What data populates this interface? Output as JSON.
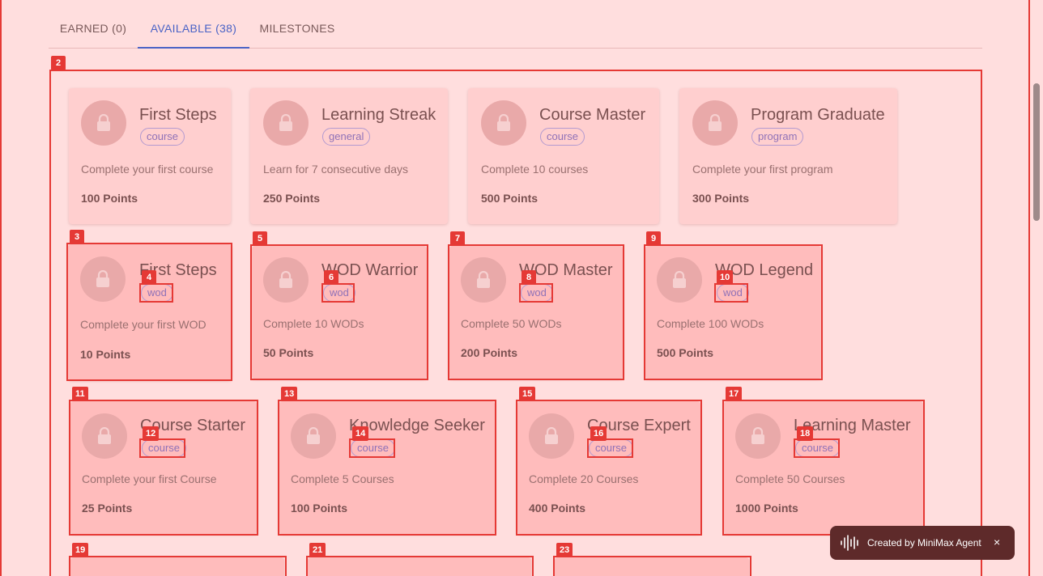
{
  "tabs": {
    "earned": "EARNED (0)",
    "available": "AVAILABLE (38)",
    "milestones": "MILESTONES"
  },
  "marks": [
    "2",
    "3",
    "4",
    "5",
    "6",
    "7",
    "8",
    "9",
    "10",
    "11",
    "12",
    "13",
    "14",
    "15",
    "16",
    "17",
    "18",
    "19",
    "21",
    "23"
  ],
  "cards": [
    {
      "title": "First Steps",
      "tag": "course",
      "desc": "Complete your first course",
      "points": "100 Points"
    },
    {
      "title": "Learning Streak",
      "tag": "general",
      "desc": "Learn for 7 consecutive days",
      "points": "250 Points"
    },
    {
      "title": "Course Master",
      "tag": "course",
      "desc": "Complete 10 courses",
      "points": "500 Points"
    },
    {
      "title": "Program Graduate",
      "tag": "program",
      "desc": "Complete your first program",
      "points": "300 Points"
    },
    {
      "title": "First Steps",
      "tag": "wod",
      "desc": "Complete your first WOD",
      "points": "10 Points"
    },
    {
      "title": "WOD Warrior",
      "tag": "wod",
      "desc": "Complete 10 WODs",
      "points": "50 Points"
    },
    {
      "title": "WOD Master",
      "tag": "wod",
      "desc": "Complete 50 WODs",
      "points": "200 Points"
    },
    {
      "title": "WOD Legend",
      "tag": "wod",
      "desc": "Complete 100 WODs",
      "points": "500 Points"
    },
    {
      "title": "Course Starter",
      "tag": "course",
      "desc": "Complete your first Course",
      "points": "25 Points"
    },
    {
      "title": "Knowledge Seeker",
      "tag": "course",
      "desc": "Complete 5 Courses",
      "points": "100 Points"
    },
    {
      "title": "Course Expert",
      "tag": "course",
      "desc": "Complete 20 Courses",
      "points": "400 Points"
    },
    {
      "title": "Learning Master",
      "tag": "course",
      "desc": "Complete 50 Courses",
      "points": "1000 Points"
    }
  ],
  "toast": {
    "text": "Created by MiniMax Agent",
    "close": "×"
  },
  "icons": {
    "lock": "lock-icon",
    "wave": "waveform-icon",
    "close": "close-icon"
  },
  "colors": {
    "accent": "#4a63c6",
    "annotation": "#e53935",
    "chip": "#9072b8"
  }
}
